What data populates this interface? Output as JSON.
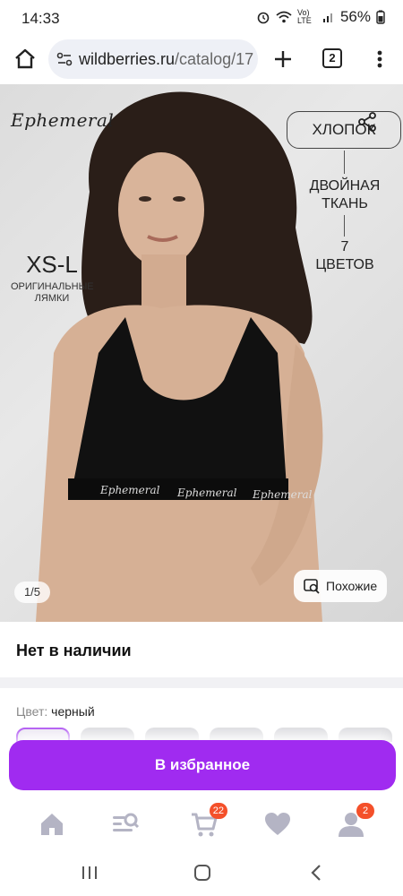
{
  "status_bar": {
    "time": "14:33",
    "battery": "56%",
    "network": "Vo) LTE"
  },
  "browser": {
    "url_domain": "wildberries.ru",
    "url_path": "/catalog/17",
    "tab_count": "2"
  },
  "product_image": {
    "brand": "Ephemeral",
    "feature_cotton": "ХЛОПОК",
    "feature_dual_line1": "ДВОЙНАЯ",
    "feature_dual_line2": "ТКАНЬ",
    "feature_colors_line1": "7",
    "feature_colors_line2": "ЦВЕТОВ",
    "sizes": "XS-L",
    "sizes_note_line1": "ОРИГИНАЛЬНЫЕ",
    "sizes_note_line2": "ЛЯМКИ",
    "band_text_1": "Ephemeral",
    "band_text_2": "Ephemeral",
    "band_text_3": "Ephemeral",
    "counter": "1/5",
    "similar_label": "Похожие"
  },
  "availability": {
    "text": "Нет в наличии"
  },
  "color": {
    "label": "Цвет:",
    "value": "черный"
  },
  "actions": {
    "favorite_label": "В избранное"
  },
  "bottom_nav": {
    "cart_badge": "22",
    "profile_badge": "2",
    "items": [
      "home-icon",
      "catalog-search-icon",
      "cart-icon",
      "heart-icon",
      "profile-icon"
    ]
  },
  "colors": {
    "accent": "#a02bf0",
    "badge": "#f4502a"
  }
}
